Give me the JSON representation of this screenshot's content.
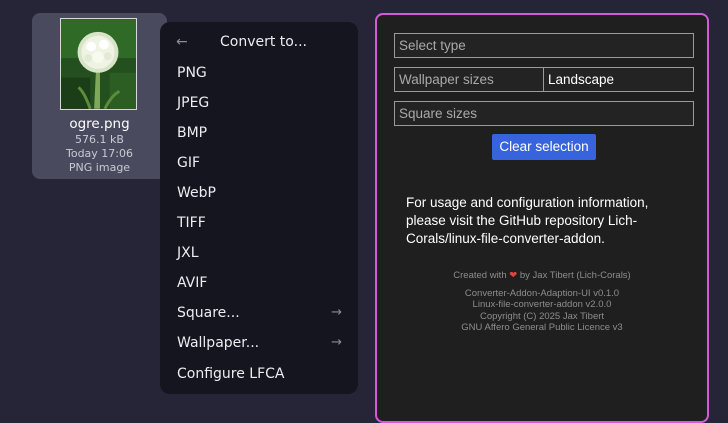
{
  "file": {
    "name": "ogre.png",
    "size": "576.1 kB",
    "modified": "Today 17:06",
    "type": "PNG image"
  },
  "menu": {
    "title": "Convert to...",
    "items": [
      {
        "label": "PNG"
      },
      {
        "label": "JPEG"
      },
      {
        "label": "BMP"
      },
      {
        "label": "GIF"
      },
      {
        "label": "WebP"
      },
      {
        "label": "TIFF"
      },
      {
        "label": "JXL"
      },
      {
        "label": "AVIF"
      },
      {
        "label": "Square...",
        "submenu": true
      },
      {
        "label": "Wallpaper...",
        "submenu": true
      },
      {
        "label": "Configure LFCA"
      }
    ]
  },
  "dialog": {
    "select_type_placeholder": "Select type",
    "wallpaper_sizes_label": "Wallpaper sizes",
    "wallpaper_sizes_value": "Landscape",
    "square_sizes_label": "Square sizes",
    "clear_button": "Clear selection",
    "info": "For usage and configuration information, please visit the GitHub repository Lich-Corals/linux-file-converter-addon.",
    "credits": {
      "created_prefix": "Created with",
      "created_suffix": "by Jax Tibert (Lich-Corals)",
      "ui_version": "Converter-Addon-Adaption-UI v0.1.0",
      "addon_version": "Linux-file-converter-addon v2.0.0",
      "copyright": "Copyright (C) 2025  Jax Tibert",
      "license": "GNU Affero General Public Licence v3"
    }
  },
  "colors": {
    "accent_border": "#d65ad8",
    "button_blue": "#3763dd",
    "heart": "#e0453a"
  }
}
